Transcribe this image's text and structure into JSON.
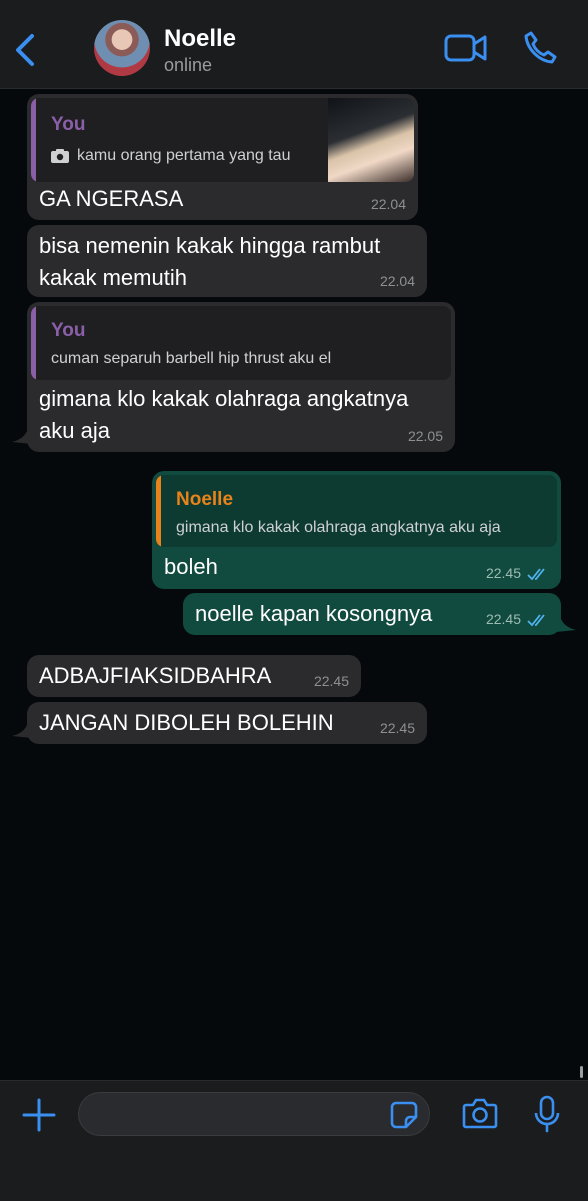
{
  "header": {
    "contact_name": "Noelle",
    "status": "online"
  },
  "messages": [
    {
      "quote_author": "You",
      "quote_text": "kamu orang pertama yang tau",
      "quote_icon": "camera-icon",
      "text": "GA NGERASA",
      "time": "22.04"
    },
    {
      "line1": "bisa nemenin kakak hingga rambut",
      "line2": "kakak memutih",
      "time": "22.04"
    },
    {
      "quote_author": "You",
      "quote_text": "cuman separuh barbell hip thrust aku el",
      "line1": "gimana klo kakak olahraga angkatnya",
      "line2": "aku aja",
      "time": "22.05"
    },
    {
      "quote_author": "Noelle",
      "quote_text": "gimana klo kakak olahraga angkatnya aku aja",
      "text": "boleh",
      "time": "22.45",
      "status": "read"
    },
    {
      "text": "noelle kapan kosongnya",
      "time": "22.45",
      "status": "read"
    },
    {
      "text": "ADBAJFIAKSIDBAHRA",
      "time": "22.45"
    },
    {
      "text": "JANGAN DIBOLEH BOLEHIN",
      "time": "22.45"
    }
  ],
  "colors": {
    "accent_blue": "#3a8ff0",
    "incoming_bubble": "#2b2b2d",
    "outgoing_bubble": "#114a3e",
    "you_quote": "#8b5fa8",
    "noelle_quote": "#e8821a",
    "read_ticks": "#4fb3f0"
  },
  "input": {
    "value": "",
    "placeholder": ""
  }
}
